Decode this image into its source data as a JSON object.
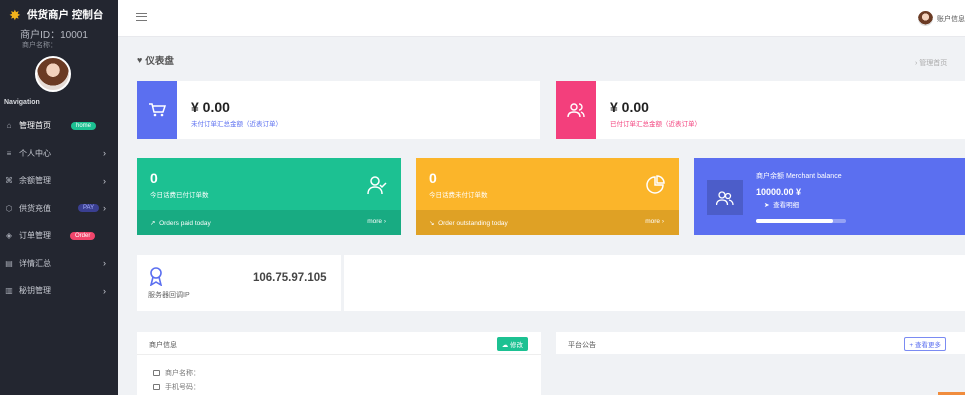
{
  "sidebar": {
    "brand": "供货商户 控制台",
    "merchant_id": "商户ID：10001",
    "merchant_name": "商户名称：",
    "nav_heading": "Navigation",
    "items": [
      {
        "icon": "home-icon",
        "glyph": "⌂",
        "label": "管理首页",
        "badge": "home"
      },
      {
        "icon": "list-icon",
        "glyph": "≡",
        "label": "个人中心"
      },
      {
        "icon": "command-icon",
        "glyph": "⌘",
        "label": "余额管理"
      },
      {
        "icon": "box-icon",
        "glyph": "⬡",
        "label": "供货充值",
        "badge": "PAY"
      },
      {
        "icon": "layers-icon",
        "glyph": "◈",
        "label": "订单管理",
        "badge": "Order"
      },
      {
        "icon": "document-icon",
        "glyph": "▤",
        "label": "详情汇总"
      },
      {
        "icon": "map-icon",
        "glyph": "▥",
        "label": "秘钥管理"
      }
    ]
  },
  "topbar": {
    "user_name": "账户信息"
  },
  "page": {
    "title": "仪表盘",
    "breadcrumb": "› 管理首页"
  },
  "summary": {
    "unpaid": {
      "amount": "¥ 0.00",
      "desc": "未付订单汇总金额（近表订单）",
      "color": "#5b6ff0"
    },
    "paid": {
      "amount": "¥ 0.00",
      "desc": "已付订单汇总金额（近表订单）",
      "color": "#f33f7c"
    }
  },
  "stats": {
    "paid_today": {
      "count": "0",
      "label": "今日话费已付订单数",
      "footer": "Orders paid today",
      "more": "more ›",
      "color": "#1cc192"
    },
    "outstanding_today": {
      "count": "0",
      "label": "今日话费未付订单数",
      "footer": "Order outstanding today",
      "more": "more ›",
      "color": "#fbb52a"
    }
  },
  "balance": {
    "title": "商户余额 Merchant balance",
    "value": "10000.00 ¥",
    "detail": "查看明细",
    "progress": 0.85,
    "color": "#5b6ff0"
  },
  "server": {
    "ip": "106.75.97.105",
    "label": "服务器回调IP"
  },
  "merchant_panel": {
    "title": "商户信息",
    "edit": "修改",
    "fields": [
      "商户名称：",
      "手机号码："
    ]
  },
  "announce_panel": {
    "title": "平台公告",
    "more": "+ 查看更多"
  }
}
